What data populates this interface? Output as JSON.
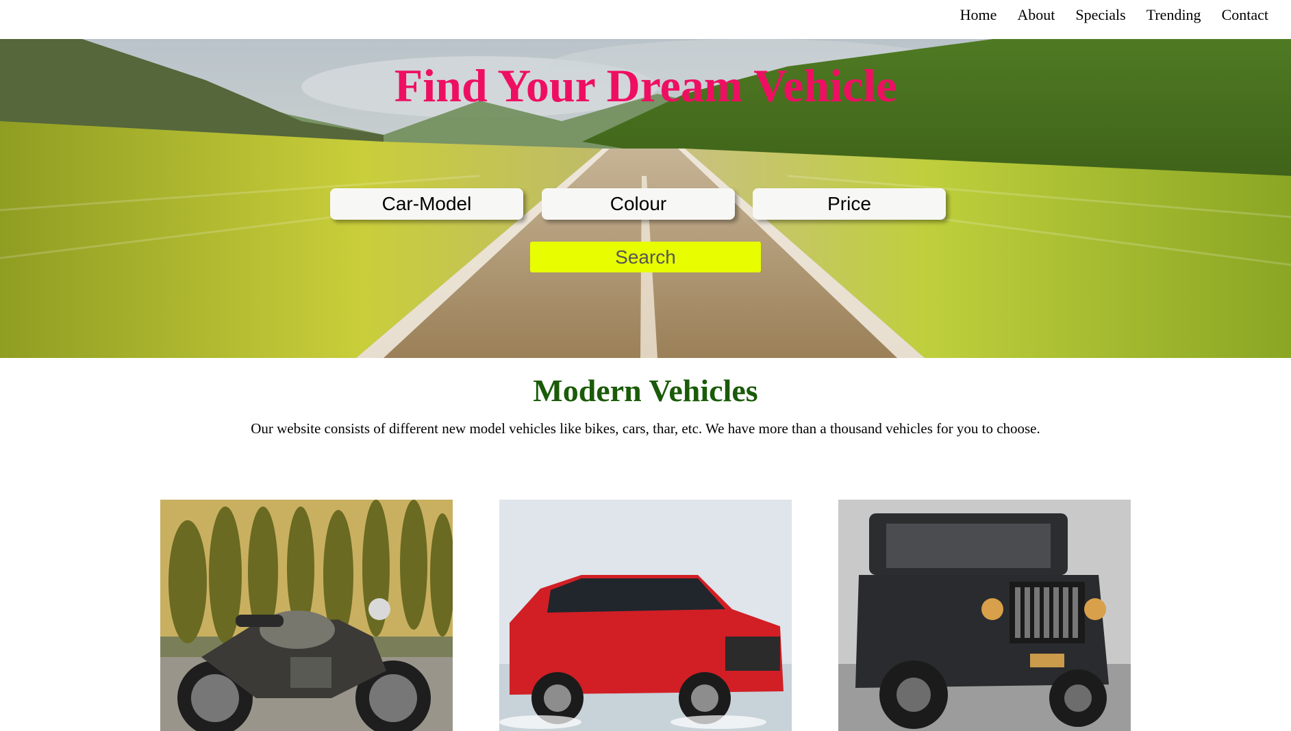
{
  "nav": {
    "items": [
      {
        "label": "Home"
      },
      {
        "label": "About"
      },
      {
        "label": "Specials"
      },
      {
        "label": "Trending"
      },
      {
        "label": "Contact"
      }
    ]
  },
  "hero": {
    "title": "Find Your Dream Vehicle",
    "filters": {
      "car_model_placeholder": "Car-Model",
      "colour_placeholder": "Colour",
      "price_placeholder": "Price"
    },
    "search_label": "Search"
  },
  "section": {
    "title": "Modern Vehicles",
    "description": "Our website consists of different new model vehicles like bikes, cars, thar, etc. We have more than a thousand vehicles for you to choose."
  },
  "colors": {
    "hero_title": "#ee0f62",
    "section_title": "#1a5b09",
    "search_button": "#e7fd00"
  }
}
